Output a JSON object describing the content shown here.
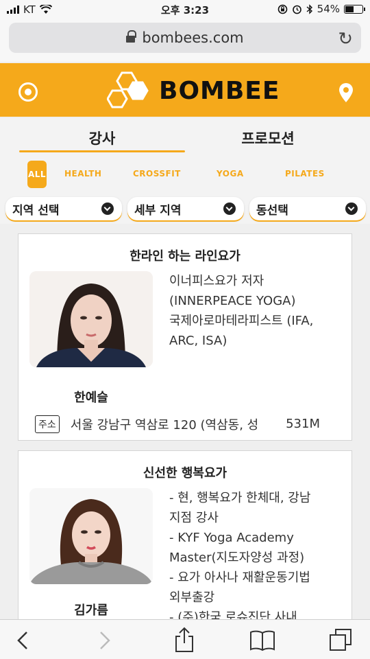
{
  "status_bar": {
    "carrier": "KT",
    "time": "오후 3:23",
    "battery": "54%",
    "battery_level": 0.54
  },
  "browser": {
    "url": "bombees.com"
  },
  "header": {
    "brand": "BOMBEE",
    "accent_color": "#f5a91b"
  },
  "tabs": [
    {
      "label": "강사",
      "active": true
    },
    {
      "label": "프로모션",
      "active": false
    }
  ],
  "categories": [
    {
      "label": "ALL",
      "active": true
    },
    {
      "label": "HEALTH"
    },
    {
      "label": "CROSSFIT"
    },
    {
      "label": "YOGA"
    },
    {
      "label": "PILATES"
    }
  ],
  "filters": [
    {
      "label": "지역 선택"
    },
    {
      "label": "세부 지역"
    },
    {
      "label": "동선택"
    }
  ],
  "cards": [
    {
      "title": "한라인 하는 라인요가",
      "name": "한예슬",
      "description": [
        "이너피스요가 저자",
        "(INNERPEACE YOGA)",
        "국제아로마테라피스트 (IFA,",
        "ARC, ISA)"
      ],
      "address_badge": "주소",
      "address": "서울 강남구 역삼로 120 (역삼동, 성",
      "distance": "531M"
    },
    {
      "title": "신선한 행복요가",
      "name": "김가름",
      "description": [
        "- 현, 행복요가 한체대, 강남",
        "지점 강사",
        "- KYF Yoga Academy",
        "Master(지도자양성 과정)",
        "- 요가 아사나 재활운동기법",
        "외부출강",
        "- (주)한국 로슈진단 사내..."
      ]
    }
  ],
  "toolbar": {
    "icons": [
      "back-icon",
      "forward-icon",
      "share-icon",
      "bookmarks-icon",
      "tabs-icon"
    ]
  }
}
